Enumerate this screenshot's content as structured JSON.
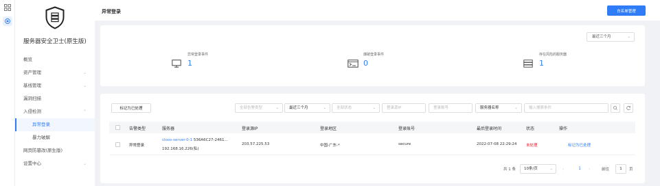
{
  "rail": {
    "grid_icon": "grid-icon",
    "active_icon": "shield-icon"
  },
  "sidebar": {
    "app_title": "服务器安全卫士(原生版)",
    "items": [
      {
        "label": "概览",
        "chevron": ""
      },
      {
        "label": "资产管理",
        "chevron": "⌄"
      },
      {
        "label": "基线管理",
        "chevron": "⌄"
      },
      {
        "label": "漏洞扫描",
        "chevron": ""
      },
      {
        "label": "入侵检测",
        "chevron": "⌃"
      },
      {
        "label": "异常登录",
        "chevron": ""
      },
      {
        "label": "暴力破解",
        "chevron": ""
      },
      {
        "label": "网页防篡改(原生版)",
        "chevron": ""
      },
      {
        "label": "设置中心",
        "chevron": "⌄"
      }
    ]
  },
  "header": {
    "title": "异常登录",
    "whitelist_button": "白名单管理"
  },
  "stats": {
    "range": "最近三个月",
    "items": [
      {
        "label": "异常登录事件",
        "value": "1",
        "icon": "monitor-icon"
      },
      {
        "label": "爆破登录事件",
        "value": "0",
        "icon": "terminal-icon"
      },
      {
        "label": "存在风险的服务器",
        "value": "1",
        "icon": "server-icon"
      }
    ]
  },
  "toolbar": {
    "mark_button": "标记为已处理",
    "alert_type_placeholder": "全部告警类型",
    "range_value": "最近三个月",
    "status_placeholder": "全部状态",
    "source_ip_placeholder": "登录源IP",
    "account_placeholder": "登录账号",
    "search_field": "服务器名称",
    "search_placeholder": "输入搜索条件"
  },
  "table": {
    "headers": [
      "告警类型",
      "服务器",
      "登录源IP",
      "登录地区",
      "登录账号",
      "最后登录时间",
      "状态",
      "操作"
    ],
    "rows": [
      {
        "type": "异常登录",
        "server_name": "cloos-server-0-1",
        "server_id": "536A6C27-2461...",
        "server_ip": "192.168.16.226(私)",
        "source_ip": "203.57.225.53",
        "region": "中国-广东-*",
        "account": "secure",
        "last_login": "2022-07-08 22:29:24",
        "status": "未处理",
        "action": "标记为已处理"
      }
    ]
  },
  "pagination": {
    "total": "共 1 条",
    "page_size": "10条/页",
    "current_page": "1",
    "goto_label": "前往",
    "goto_value": "1",
    "page_unit": "页"
  },
  "colors": {
    "accent": "#2f7cf6",
    "danger": "#f5222d"
  }
}
